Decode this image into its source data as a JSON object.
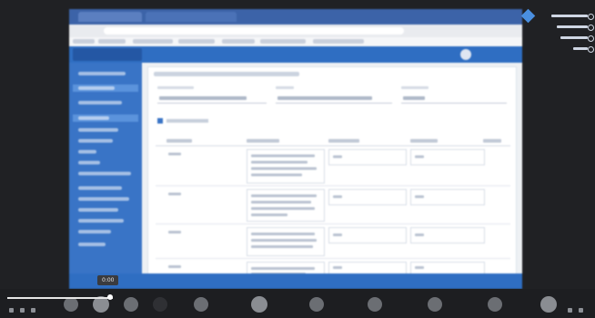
{
  "app": {
    "title": ""
  },
  "tooltip": {
    "text": "0:00"
  },
  "colors": {
    "primary": "#3974c6",
    "app_bar": "#2f6ec2",
    "bg": "#eef1f4"
  },
  "toolbar": {
    "buttons": [
      "mic-icon",
      "video-icon",
      "share-icon",
      "record-icon",
      "chat-icon",
      "participants-icon",
      "reactions-icon",
      "settings-icon",
      "more-icon"
    ]
  }
}
